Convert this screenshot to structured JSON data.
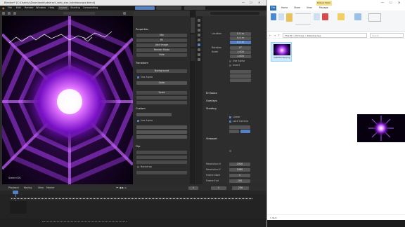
{
  "blender": {
    "title": "Blender* [C:\\Users\\c\\Downloads\\abstract_web_star_kaleidoscope.blend]",
    "menus": [
      "File",
      "Edit",
      "Render",
      "Window",
      "Help"
    ],
    "workspace_tabs": [
      "Layout",
      "Shading",
      "Compositing"
    ],
    "viewport": {
      "frame_label": "Scene.001",
      "overlay_text": "Kaleidoscope"
    },
    "tool_panel": {
      "items": [
        "Mix",
        "Fill",
        "Add Image",
        "Render Mode",
        "Hide",
        "Background",
        "Color",
        "Scale"
      ],
      "checks": [
        "Use Alpha",
        "Use Alpha",
        "Backdrop"
      ],
      "sections": [
        "Properties",
        "Transform",
        "Custom",
        "Flip"
      ]
    },
    "properties": {
      "tabs": [
        "Tool",
        "Item",
        "View"
      ],
      "fields": [
        {
          "label": "Location",
          "value": "0.0 m"
        },
        {
          "label": "",
          "value": "0.0 m"
        },
        {
          "label": "",
          "value": "0.0 m"
        },
        {
          "label": "Rotation",
          "value": "0°"
        },
        {
          "label": "Scale",
          "value": "1.000"
        },
        {
          "label": "",
          "value": "1.000"
        }
      ],
      "checkbox_items": [
        "Use Alpha",
        "Invert",
        "Linear",
        "Lock Camera"
      ],
      "panel_items": [
        "Emission",
        "Overlays",
        "Shading",
        "Viewport"
      ],
      "bottom_fields": [
        {
          "label": "Resolution X",
          "value": "1920"
        },
        {
          "label": "Resolution Y",
          "value": "1080"
        },
        {
          "label": "Frame Start",
          "value": "1"
        },
        {
          "label": "Frame End",
          "value": "250"
        }
      ]
    },
    "timeline": {
      "labels": [
        "Playback",
        "Keying",
        "View",
        "Marker"
      ],
      "current_frame": "1",
      "start": "1",
      "end": "250"
    }
  },
  "explorer": {
    "ribbon_tab_active": "Picture Tools",
    "ribbon_tabs": [
      "File",
      "Home",
      "Share",
      "View",
      "Manage"
    ],
    "address": "This PC > Pictures > Kaleidoscope",
    "search_placeholder": "Search",
    "file": {
      "name": "kaleidoscope.png"
    },
    "status": "1 item"
  },
  "colors": {
    "accent": "#5680c2",
    "purple": "#b040ff",
    "blender_bg": "#303030"
  }
}
